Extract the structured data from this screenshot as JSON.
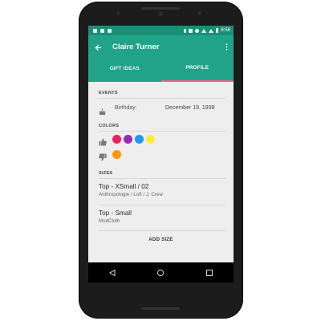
{
  "statusbar": {
    "time": "8:56"
  },
  "appbar": {
    "title": "Claire Turner"
  },
  "tabs": [
    {
      "label": "GIFT IDEAS"
    },
    {
      "label": "PROFILE"
    }
  ],
  "events": {
    "header": "EVENTS",
    "items": [
      {
        "label": "Birthday:",
        "value": "December 19, 1998"
      }
    ]
  },
  "colors": {
    "header": "COLORS",
    "likes": [
      "#e91e63",
      "#9c27b0",
      "#2196f3",
      "#ffeb3b"
    ],
    "dislikes": [
      "#ff9800"
    ]
  },
  "sizes": {
    "header": "SIZES",
    "items": [
      {
        "title": "Top - XSmall / 02",
        "stores": "Anthropologie / Loft / J. Crew"
      },
      {
        "title": "Top - Small",
        "stores": "ModCloth"
      }
    ],
    "add_label": "ADD SIZE"
  },
  "icons": {
    "back": "arrow-back-icon",
    "overflow": "more-vert-icon",
    "event": "cake-icon",
    "like": "thumb-up-icon",
    "dislike": "thumb-down-icon"
  },
  "theme": {
    "primary": "#20a388",
    "primary_dark": "#1a8f76",
    "accent": "#f06292"
  }
}
